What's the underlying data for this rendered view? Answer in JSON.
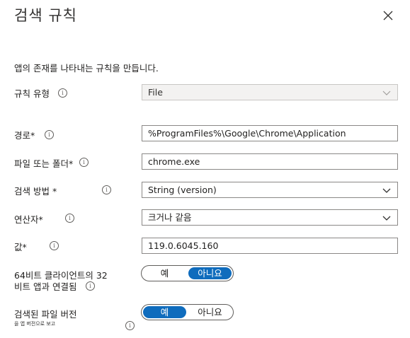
{
  "panel": {
    "title": "검색 규칙",
    "description": "앱의 존재를 나타내는 규칙을 만듭니다."
  },
  "fields": {
    "rule_type": {
      "label": "규칙 유형",
      "value": "File"
    },
    "path": {
      "label": "경로*",
      "value": "%ProgramFiles%\\Google\\Chrome\\Application"
    },
    "file_or_folder": {
      "label": "파일 또는 폴더*",
      "value": "chrome.exe"
    },
    "detection_method": {
      "label": "검색 방법 *",
      "value": "String (version)"
    },
    "operator": {
      "label": "연산자*",
      "value": "크거나 같음"
    },
    "value": {
      "label": "값*",
      "value": "119.0.6045.160"
    },
    "bit32": {
      "label_line1": "64비트 클라이언트의 32",
      "label_line2": "비트 앱과 연결됨",
      "yes": "예",
      "no": "아니요",
      "selected": "no"
    },
    "version": {
      "label": "검색된 파일 버전",
      "sub": "을 앱 버전으로 보고",
      "yes": "예",
      "no": "아니요",
      "selected": "yes"
    }
  },
  "icons": {
    "close": "close-icon",
    "info": "info-icon",
    "chevron": "chevron-down-icon"
  }
}
